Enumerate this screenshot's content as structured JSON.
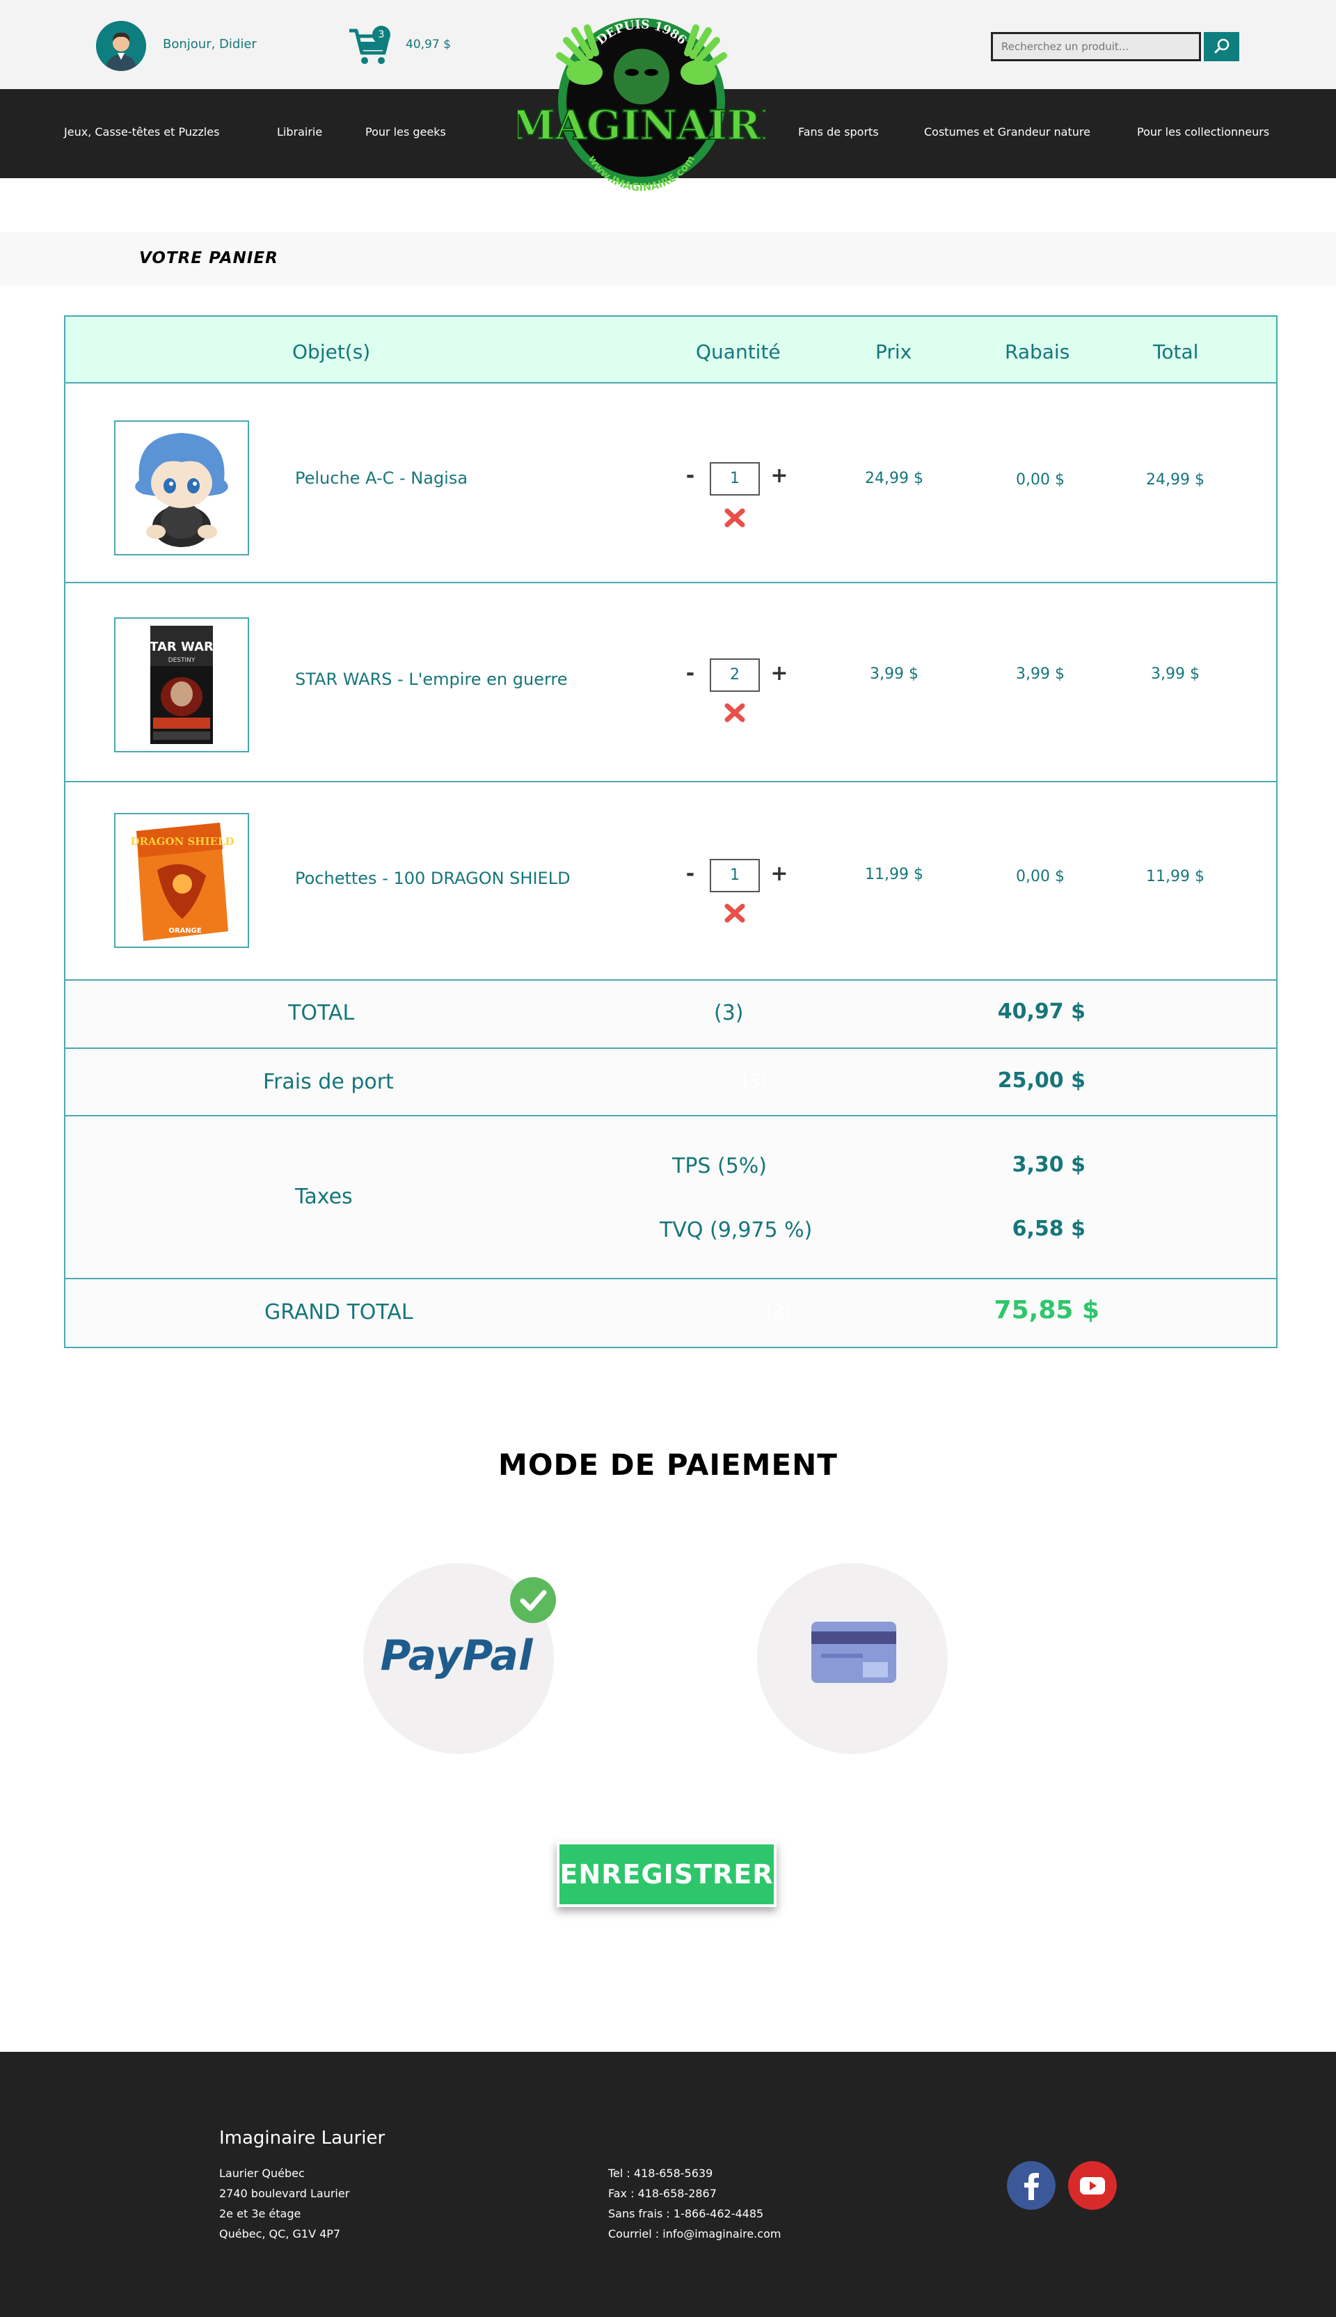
{
  "header": {
    "greeting": "Bonjour, Didier",
    "cart_count": "3",
    "cart_total": "40,97 $",
    "search_placeholder": "Recherchez un produit...",
    "logo": {
      "top_text": "DEPUIS 1986",
      "brand": "IMAGINAIRE",
      "bottom_text": "www.IMAGINAIRE.com"
    }
  },
  "nav": {
    "left": [
      "Jeux, Casse-têtes et Puzzles",
      "Librairie",
      "Pour les geeks"
    ],
    "right": [
      "Fans de sports",
      "Costumes et Grandeur nature",
      "Pour les collectionneurs"
    ]
  },
  "cart": {
    "section_title": "VOTRE PANIER",
    "columns": [
      "Objet(s)",
      "Quantité",
      "Prix",
      "Rabais",
      "Total"
    ],
    "items": [
      {
        "name": "Peluche A-C - Nagisa",
        "qty": "1",
        "price": "24,99 $",
        "discount": "0,00 $",
        "total": "24,99 $"
      },
      {
        "name": "STAR WARS - L'empire en guerre",
        "qty": "2",
        "price": "3,99 $",
        "discount": "3,99 $",
        "total": "3,99 $"
      },
      {
        "name": "Pochettes - 100 DRAGON SHIELD",
        "qty": "1",
        "price": "11,99 $",
        "discount": "0,00 $",
        "total": "11,99 $"
      }
    ],
    "product_image_text": {
      "starwars": "STAR WARS",
      "starwars_sub": "DESTINY",
      "dragon": "DRAGON SHIELD",
      "dragon_sub": "ORANGE"
    },
    "summary": {
      "total_label": "TOTAL",
      "total_count": "(3)",
      "total_value": "40,97 $",
      "shipping_label": "Frais de port",
      "shipping_ghost": "(3)",
      "shipping_value": "25,00 $",
      "taxes_label": "Taxes",
      "tps_label": "TPS (5%)",
      "tps_value": "3,30 $",
      "tvq_label": "TVQ (9,975 %)",
      "tvq_value": "6,58 $",
      "grand_label": "GRAND TOTAL",
      "grand_ghost": "(3)",
      "grand_value": "75,85 $"
    }
  },
  "payment": {
    "title": "MODE DE PAIEMENT",
    "paypal_label": "PayPal",
    "save_label": "ENREGISTRER"
  },
  "footer": {
    "title": "Imaginaire Laurier",
    "address": [
      "Laurier Québec",
      "2740 boulevard Laurier",
      "2e et 3e étage",
      "Québec, QC, G1V 4P7"
    ],
    "contacts": [
      "Tel : 418-658-5639",
      "Fax : 418-658-2867",
      "Sans frais : 1-866-462-4485",
      "Courriel : info@imaginaire.com"
    ]
  },
  "colors": {
    "teal": "#16767a",
    "accent_green": "#2ec66b",
    "header_bg": "#dcfff0",
    "dark": "#222222",
    "delete_red": "#e8504a"
  }
}
